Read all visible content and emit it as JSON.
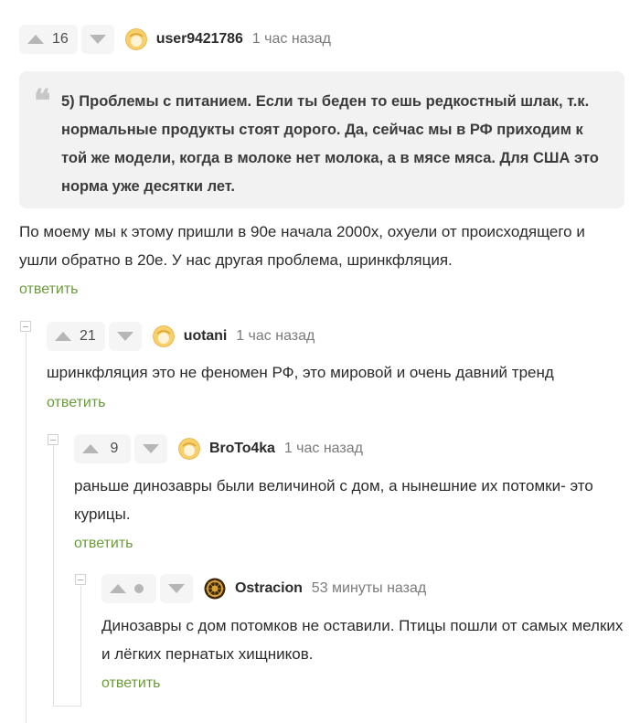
{
  "colors": {
    "reply": "#6b9b3a",
    "vote_bg": "#f5f5f5",
    "quote_bg": "#f2f2f2"
  },
  "comment1": {
    "votes": "16",
    "user": "user9421786",
    "time": "1 час назад",
    "quote": "5) Проблемы с питанием. Если ты беден то ешь редкостный шлак, т.к. нормальные продукты стоят дорого. Да, сейчас мы в РФ приходим к той же модели, когда в молоке нет молока, а в мясе мяса. Для США это норма уже десятки лет.",
    "text": "По моему мы к этому пришли в 90е начала 2000х, охуели от происходящего и ушли обратно в 20е. У нас другая проблема, шринкфляция.",
    "reply": "ответить"
  },
  "comment2": {
    "votes": "21",
    "user": "uotani",
    "time": "1 час назад",
    "text": "шринкфляция это не феномен РФ, это мировой и очень давний тренд",
    "reply": "ответить"
  },
  "comment3": {
    "votes": "9",
    "user": "BroTo4ka",
    "time": "1 час назад",
    "text": "раньше динозавры были величиной с дом, а нынешние их потомки- это курицы.",
    "reply": "ответить"
  },
  "comment4": {
    "user": "Ostracion",
    "time": "53 минуты назад",
    "text": "Динозавры с дом потомков не оставили. Птицы пошли от самых мелких и лёгких пернатых хищников.",
    "reply": "ответить"
  }
}
